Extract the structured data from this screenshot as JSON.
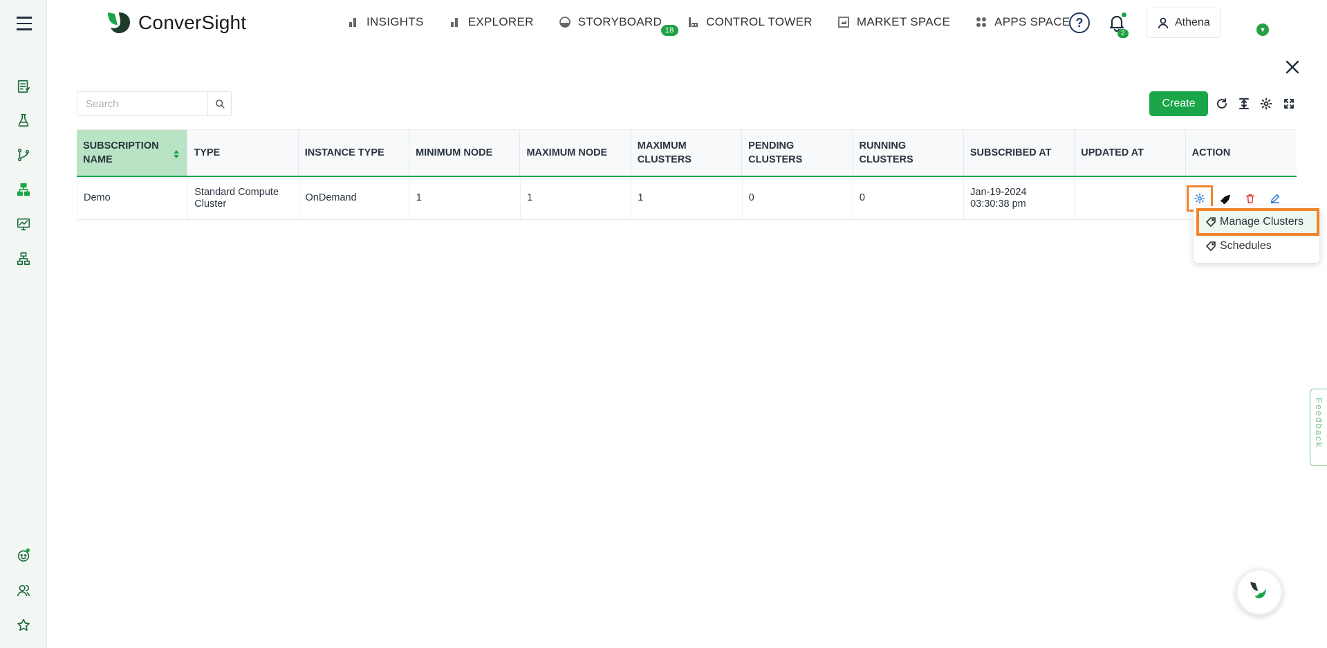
{
  "app": {
    "brand_name": "ConverSight",
    "accent": "#1aa648"
  },
  "nav": {
    "items": [
      {
        "label": "INSIGHTS",
        "icon": "bar-chart-icon"
      },
      {
        "label": "EXPLORER",
        "icon": "bar-chart-icon"
      },
      {
        "label": "STORYBOARD",
        "icon": "storyboard-icon",
        "badge": "18"
      },
      {
        "label": "CONTROL TOWER",
        "icon": "tower-icon"
      },
      {
        "label": "MARKET SPACE",
        "icon": "market-icon"
      },
      {
        "label": "APPS SPACE",
        "icon": "apps-icon"
      }
    ]
  },
  "header": {
    "help_glyph": "?",
    "notifications_count": "2",
    "user_name": "Athena"
  },
  "toolbar": {
    "search_placeholder": "Search",
    "create_label": "Create"
  },
  "table": {
    "columns": [
      "SUBSCRIPTION NAME",
      "TYPE",
      "INSTANCE TYPE",
      "MINIMUM NODE",
      "MAXIMUM NODE",
      "MAXIMUM CLUSTERS",
      "PENDING CLUSTERS",
      "RUNNING CLUSTERS",
      "SUBSCRIBED AT",
      "UPDATED AT",
      "ACTION"
    ],
    "rows": [
      {
        "subscription_name": "Demo",
        "type": "Standard Compute Cluster",
        "instance_type": "OnDemand",
        "minimum_node": "1",
        "maximum_node": "1",
        "maximum_clusters": "1",
        "pending_clusters": "0",
        "running_clusters": "0",
        "subscribed_at": "Jan-19-2024 03:30:38 pm",
        "updated_at": ""
      }
    ]
  },
  "action_menu": {
    "items": [
      "Manage Clusters",
      "Schedules"
    ]
  },
  "feedback_label": "Feedback"
}
